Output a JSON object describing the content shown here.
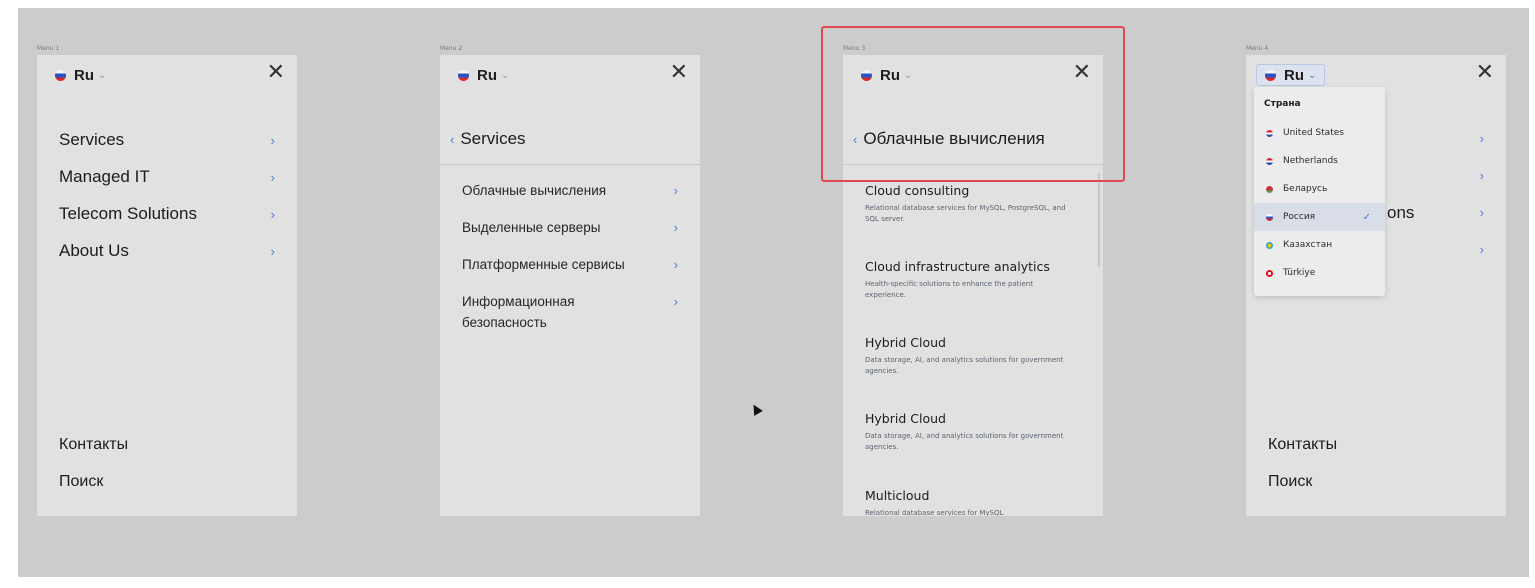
{
  "frames": {
    "f1": {
      "label": "Menu 1",
      "lang": "Ru",
      "nav": [
        "Services",
        "Managed IT",
        "Telecom Solutions",
        "About Us"
      ],
      "bottom": [
        "Контакты",
        "Поиск"
      ]
    },
    "f2": {
      "label": "Menu 2",
      "lang": "Ru",
      "back_title": "Services",
      "items": [
        "Облачные вычисления",
        "Выделенные серверы",
        "Платформенные сервисы",
        "Информационная безопасность"
      ]
    },
    "f3": {
      "label": "Menu 3",
      "lang": "Ru",
      "back_title": "Облачные вычисления",
      "items": [
        {
          "title": "Cloud consulting",
          "desc": "Relational database services for MySQL, PostgreSQL, and SQL server."
        },
        {
          "title": "Cloud infrastructure analytics",
          "desc": "Health-specific solutions to enhance the patient experience."
        },
        {
          "title": "Hybrid Cloud",
          "desc": "Data storage, AI, and analytics solutions for government agencies."
        },
        {
          "title": "Hybrid Cloud",
          "desc": "Data storage, AI, and analytics solutions for government agencies."
        },
        {
          "title": "Multicloud",
          "desc": "Relational database services for MySQL"
        }
      ]
    },
    "f4": {
      "label": "Menu 4",
      "lang": "Ru",
      "partial_nav_text": "ons",
      "bottom": [
        "Контакты",
        "Поиск"
      ],
      "dropdown": {
        "title": "Страна",
        "items": [
          "United States",
          "Netherlands",
          "Беларусь",
          "Россия",
          "Казахстан",
          "Türkiye"
        ],
        "selected": "Россия"
      }
    }
  },
  "icons": {
    "close": "✕",
    "chevron_right": "›",
    "chevron_left": "‹",
    "chevron_down": "⌄",
    "check": "✓"
  },
  "colors": {
    "canvas": "#cccccc",
    "frame": "#e1e1e1",
    "accent": "#4c7bd9",
    "highlight": "#e0484f"
  }
}
